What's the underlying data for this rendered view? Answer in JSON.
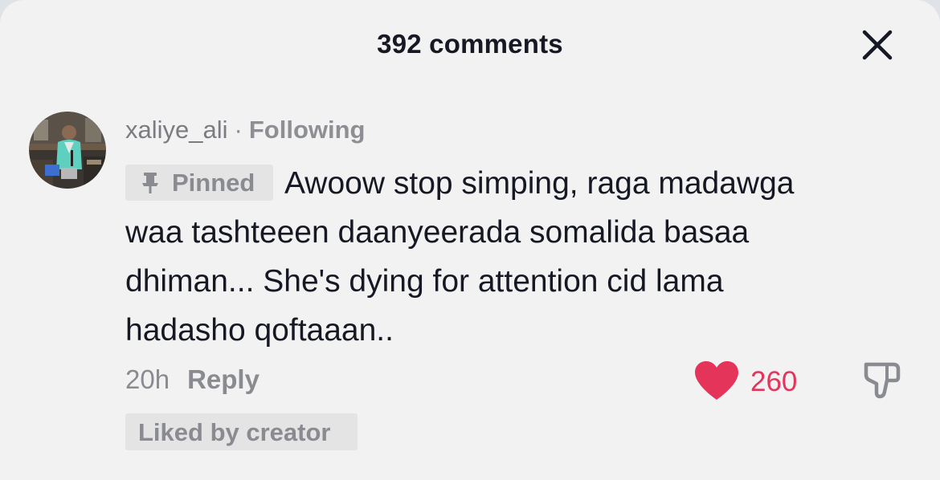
{
  "header": {
    "title": "392 comments",
    "close_icon": "close-icon"
  },
  "comment": {
    "avatar_icon": "user-avatar",
    "username": "xaliye_ali",
    "separator": "·",
    "relationship": "Following",
    "pinned_label": "Pinned",
    "pin_icon": "pin-icon",
    "text": "Awoow stop simping, raga madawga waa tashteeen daanyeerada somalida basaa dhiman... She's dying for attention cid lama hadasho qoftaaan..",
    "time": "20h",
    "reply_label": "Reply",
    "like_icon": "heart-icon",
    "like_count": "260",
    "liked": true,
    "dislike_icon": "thumbs-down-icon",
    "liked_by_creator_label": "Liked by creator"
  },
  "colors": {
    "background": "#f2f2f2",
    "text_primary": "#161823",
    "text_secondary": "#8a8b91",
    "like_red": "#e5345a",
    "badge_bg": "#e4e4e4"
  }
}
